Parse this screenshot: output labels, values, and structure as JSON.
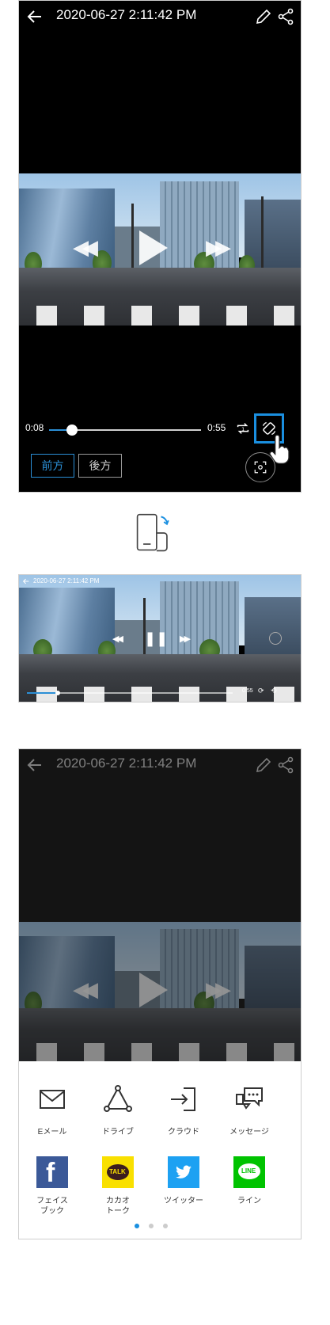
{
  "player": {
    "title": "2020-06-27 2:11:42 PM",
    "progress": 0.15,
    "time_current": "0:08",
    "time_total": "0:55",
    "cameras": [
      {
        "label": "前方",
        "active": true
      },
      {
        "label": "後方",
        "active": false
      }
    ]
  },
  "landscape": {
    "title": "2020-06-27 2:11:42 PM",
    "time_total": "0:55"
  },
  "share_screen": {
    "title": "2020-06-27 2:11:42 PM"
  },
  "share_sheet": {
    "apps_row1": [
      {
        "label": "Eメール",
        "icon": "mail-icon"
      },
      {
        "label": "ドライブ",
        "icon": "drive-icon"
      },
      {
        "label": "クラウド",
        "icon": "cloud-import-icon"
      },
      {
        "label": "メッセージ",
        "icon": "message-icon"
      }
    ],
    "apps_row2": [
      {
        "label": "フェイス\nブック",
        "icon": "facebook-icon",
        "color": "#3b5998"
      },
      {
        "label": "カカオ\nトーク",
        "icon": "kakaotalk-icon",
        "color": "#f9e000"
      },
      {
        "label": "ツイッター",
        "icon": "twitter-icon",
        "color": "#1da1f2"
      },
      {
        "label": "ライン",
        "icon": "line-icon",
        "color": "#00c300"
      }
    ],
    "kakao_badge": "TALK",
    "line_badge": "LINE",
    "page_dots": 3,
    "active_dot": 0
  },
  "colors": {
    "accent": "#2b8fd6",
    "highlight_box": "#1a8fe0"
  }
}
